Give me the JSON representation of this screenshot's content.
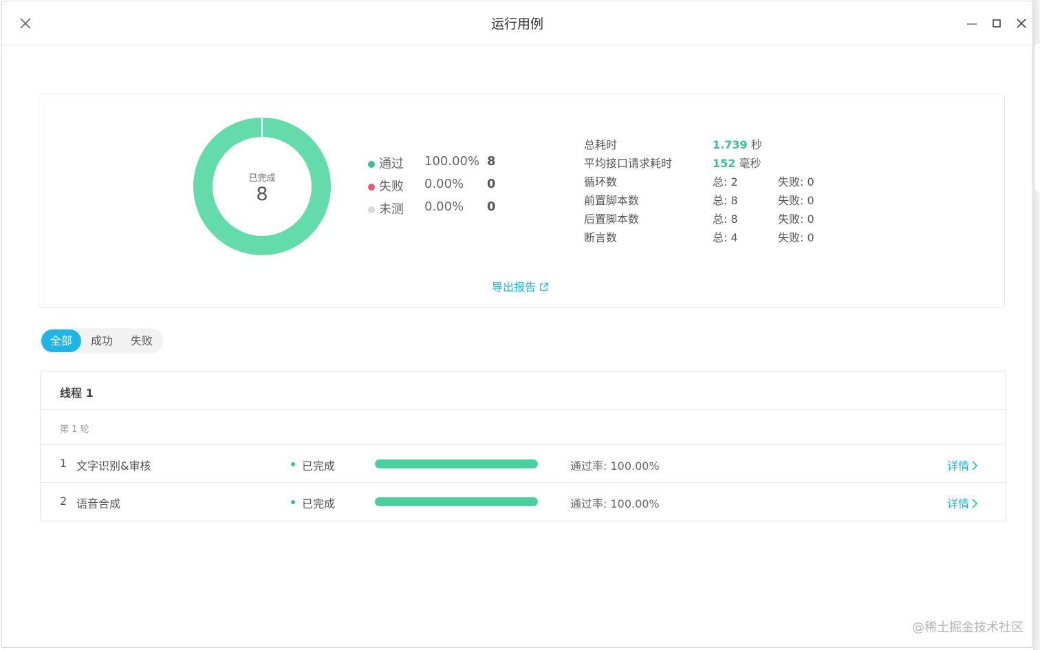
{
  "window": {
    "title": "运行用例"
  },
  "summary": {
    "donut": {
      "label": "已完成",
      "value": "8",
      "pass_fraction": 1.0,
      "color": "#64dbab"
    },
    "legend": [
      {
        "name": "通过",
        "percent": "100.00%",
        "count": "8",
        "color": "#3cc08f"
      },
      {
        "name": "失败",
        "percent": "0.00%",
        "count": "0",
        "color": "#f0557a"
      },
      {
        "name": "未测",
        "percent": "0.00%",
        "count": "0",
        "color": "#d9d9d9"
      }
    ],
    "stats": [
      {
        "label": "总耗时",
        "value": "1.739",
        "unit": " 秒"
      },
      {
        "label": "平均接口请求耗时",
        "value": "152",
        "unit": " 毫秒"
      },
      {
        "label": "循环数",
        "total": "总: 2",
        "failed": "失败: 0"
      },
      {
        "label": "前置脚本数",
        "total": "总: 8",
        "failed": "失败: 0"
      },
      {
        "label": "后置脚本数",
        "total": "总: 8",
        "failed": "失败: 0"
      },
      {
        "label": "断言数",
        "total": "总: 4",
        "failed": "失败: 0"
      }
    ],
    "export_label": "导出报告"
  },
  "filters": {
    "all": "全部",
    "success": "成功",
    "fail": "失败",
    "active": "all"
  },
  "thread": {
    "title": "线程 1",
    "round": "第 1 轮",
    "cases": [
      {
        "index": "1",
        "name": "文字识别&审核",
        "status": "已完成",
        "progress": 1.0,
        "rate": "通过率: 100.00%",
        "detail": "详情"
      },
      {
        "index": "2",
        "name": "语音合成",
        "status": "已完成",
        "progress": 1.0,
        "rate": "通过率: 100.00%",
        "detail": "详情"
      }
    ]
  },
  "watermark": "@稀土掘金技术社区",
  "colors": {
    "accent": "#1fb5e6",
    "success": "#3cc08f",
    "danger": "#f0557a",
    "muted": "#d9d9d9"
  }
}
